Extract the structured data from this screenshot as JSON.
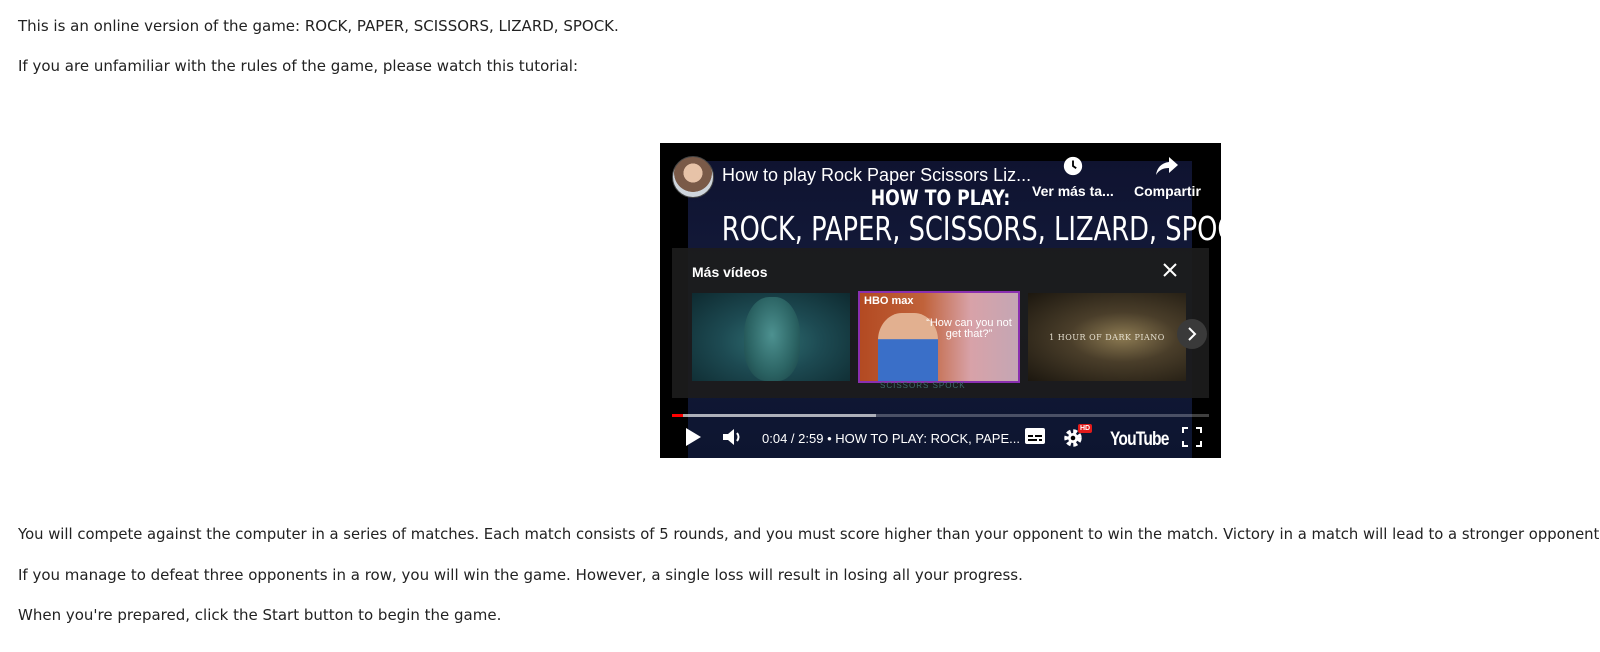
{
  "intro": {
    "line1": "This is an online version of the game: ROCK, PAPER, SCISSORS, LIZARD, SPOCK.",
    "line2": "If you are unfamiliar with the rules of the game, please watch this tutorial:"
  },
  "video": {
    "title": "How to play Rock Paper Scissors Liz...",
    "watch_later_label": "Ver más ta...",
    "share_label": "Compartir",
    "frame_heading": "HOW TO PLAY:",
    "frame_title": "ROCK, PAPER, SCISSORS, LIZARD, SPOCK",
    "more_videos": {
      "title": "Más vídeos",
      "thumbnails": [
        {
          "name": "dark-face-video",
          "text": ""
        },
        {
          "name": "hbomax-video",
          "brand": "HBO max",
          "quote": "“How can you not get that?”"
        },
        {
          "name": "dark-piano-video",
          "text": "1 HOUR OF DARK PIANO"
        }
      ]
    },
    "emblem_text": "SCISSORS      SPOCK",
    "progress": {
      "played_fraction": 0.02,
      "buffered_fraction": 0.38
    },
    "time_display": "0:04 / 2:59",
    "chapter": "HOW TO PLAY: ROCK, PAPE...",
    "hd_badge": "HD",
    "logo_text": "YouTube",
    "icons": [
      "play-icon",
      "volume-icon",
      "subtitles-icon",
      "settings-icon",
      "fullscreen-icon",
      "clock-icon",
      "share-icon",
      "close-icon",
      "chevron-right-icon"
    ]
  },
  "rules": {
    "line1": "You will compete against the computer in a series of matches. Each match consists of 5 rounds, and you must score higher than your opponent to win the match. Victory in a match will lead to a stronger opponent.",
    "line2": "If you manage to defeat three opponents in a row, you will win the game. However, a single loss will result in losing all your progress.",
    "line3": "When you're prepared, click the Start button to begin the game."
  }
}
